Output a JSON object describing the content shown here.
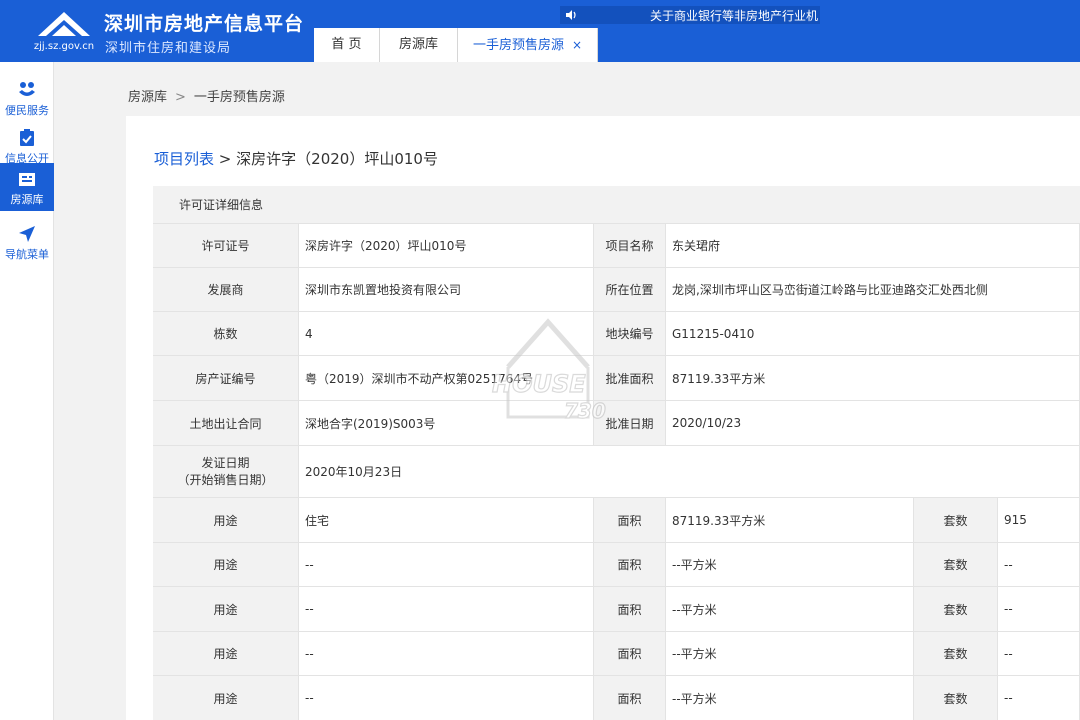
{
  "header": {
    "site_domain": "zjj.sz.gov.cn",
    "title": "深圳市房地产信息平台",
    "subtitle": "深圳市住房和建设局",
    "announcement": "关于商业银行等非房地产行业机",
    "tabs": [
      {
        "label": "首 页"
      },
      {
        "label": "房源库"
      },
      {
        "label": "一手房预售房源",
        "close": "×"
      }
    ]
  },
  "sidebar": {
    "items": [
      {
        "label": "便民服务",
        "icon": "people-icon"
      },
      {
        "label": "信息公开",
        "icon": "clipboard-check-icon"
      },
      {
        "label": "房源库",
        "icon": "house-list-icon"
      },
      {
        "label": "导航菜单",
        "icon": "navigation-arrow-icon"
      }
    ]
  },
  "breadcrumb": {
    "root": "房源库",
    "separator": ">",
    "current": "一手房预售房源"
  },
  "page_title": {
    "link": "项目列表",
    "separator": ">",
    "current": "深房许字（2020）坪山010号"
  },
  "section_header": "许可证详细信息",
  "details": {
    "permit_no_label": "许可证号",
    "permit_no": "深房许字（2020）坪山010号",
    "project_name_label": "项目名称",
    "project_name": "东关珺府",
    "developer_label": "发展商",
    "developer": "深圳市东凯置地投资有限公司",
    "location_label": "所在位置",
    "location": "龙岗,深圳市坪山区马峦街道江岭路与比亚迪路交汇处西北侧",
    "buildings_label": "栋数",
    "buildings": "4",
    "plot_no_label": "地块编号",
    "plot_no": "G11215-0410",
    "property_cert_label": "房产证编号",
    "property_cert": "粤（2019）深圳市不动产权第0251764号",
    "approved_area_label": "批准面积",
    "approved_area": "87119.33平方米",
    "land_contract_label": "土地出让合同",
    "land_contract": "深地合字(2019)S003号",
    "approval_date_label": "批准日期",
    "approval_date": "2020/10/23",
    "issue_date_label_1": "发证日期",
    "issue_date_label_2": "（开始销售日期）",
    "issue_date": "2020年10月23日"
  },
  "usage_rows": [
    {
      "use_label": "用途",
      "use": "住宅",
      "area_label": "面积",
      "area": "87119.33平方米",
      "units_label": "套数",
      "units": "915"
    },
    {
      "use_label": "用途",
      "use": "--",
      "area_label": "面积",
      "area": "--平方米",
      "units_label": "套数",
      "units": "--"
    },
    {
      "use_label": "用途",
      "use": "--",
      "area_label": "面积",
      "area": "--平方米",
      "units_label": "套数",
      "units": "--"
    },
    {
      "use_label": "用途",
      "use": "--",
      "area_label": "面积",
      "area": "--平方米",
      "units_label": "套数",
      "units": "--"
    },
    {
      "use_label": "用途",
      "use": "--",
      "area_label": "面积",
      "area": "--平方米",
      "units_label": "套数",
      "units": "--"
    }
  ],
  "watermark": {
    "line1": "HOUSE",
    "line2": "730"
  },
  "colors": {
    "brand_blue": "#1a5fd6",
    "label_bg": "#f2f2f2",
    "border": "#e3e3e3"
  }
}
